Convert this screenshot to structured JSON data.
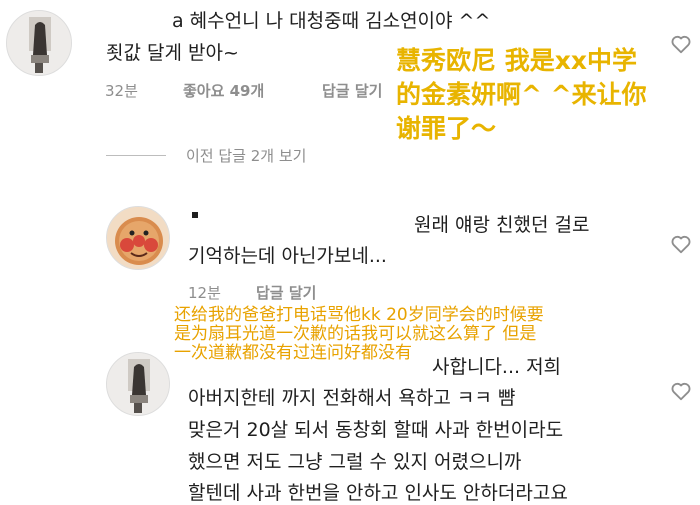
{
  "comment1": {
    "text_line1": "a 혜수언니 나 대청중때 김소연이야 ^^",
    "text_line2": "죗값 달게 받아~",
    "time": "32분",
    "likes": "좋아요 49개",
    "reply": "답글 달기",
    "overlay_cn_lines": [
      "慧秀欧尼 我是xx中学",
      "的金素妍啊^ ^来让你",
      "谢罪了～"
    ]
  },
  "view_previous": "이전 답글 2개 보기",
  "comment2": {
    "text_line1": "원래 얘랑 친했던 걸로",
    "text_line2": "기억하는데 아닌가보네...",
    "time": "12분",
    "reply": "답글 달기"
  },
  "comment3": {
    "overlay_cn_lines": [
      "还给我的爸爸打电话骂他kk 20岁同学会的时候要",
      "是为扇耳光道一次歉的话我可以就这么算了 但是",
      "一次道歉都没有过连问好都没有"
    ],
    "text_line1_tail": "사합니다... 저희",
    "text_line2": "아버지한테 까지 전화해서 욕하고 ㅋㅋ 뺨",
    "text_line3": "맞은거 20살 되서 동창회 할때 사과 한번이라도",
    "text_line4": "했으면 저도 그냥 그럴 수 있지 어렸으니까",
    "text_line5": "할텐데 사과 한번을 안하고 인사도 안하더라고요"
  },
  "colors": {
    "overlay": "#e8b400",
    "meta": "#8e8e8e"
  }
}
